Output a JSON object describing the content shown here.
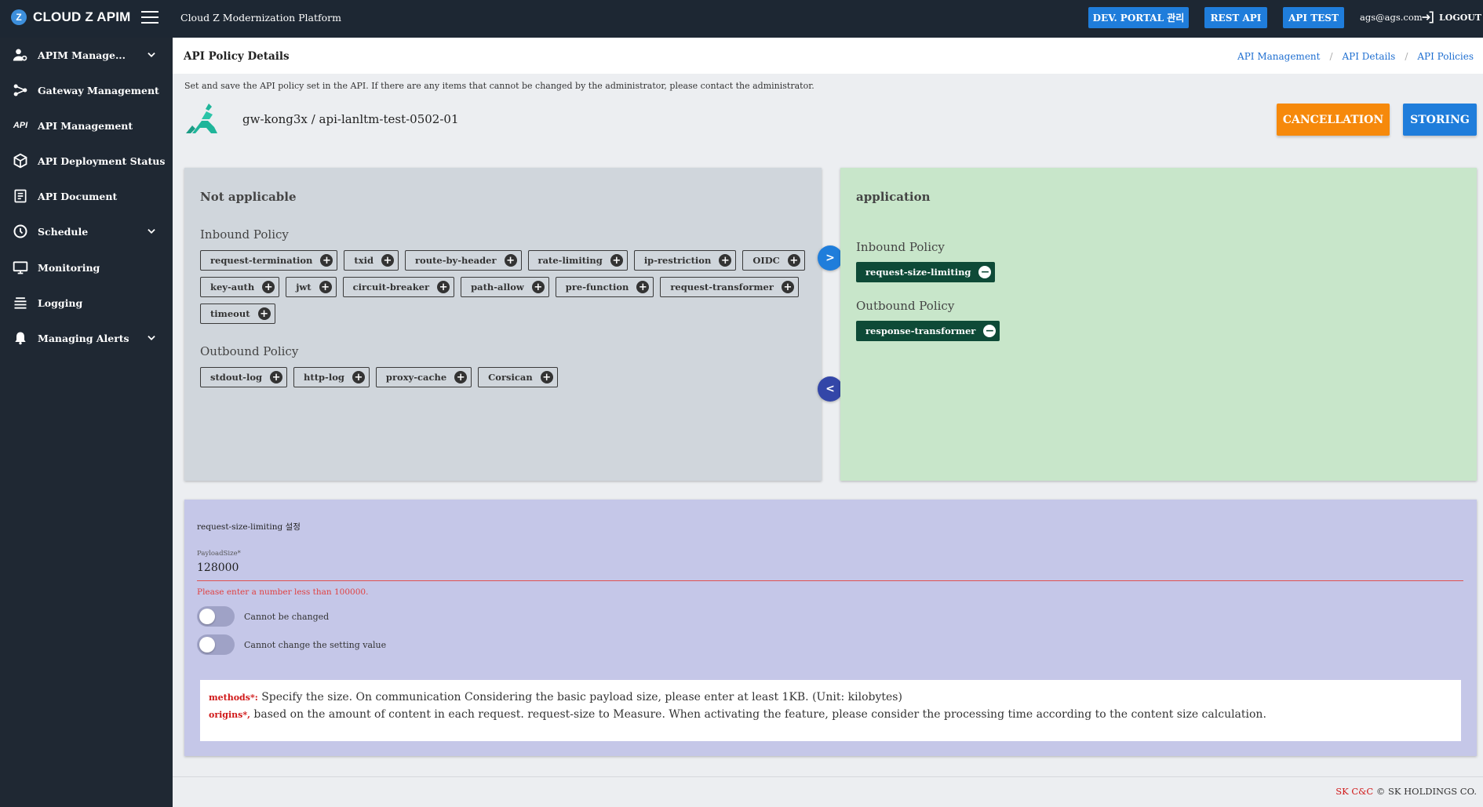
{
  "topbar": {
    "logo_text": "CLOUD Z APIM",
    "logo_letter": "Z",
    "platform_title": "Cloud Z Modernization Platform",
    "buttons": [
      "DEV. PORTAL 관리",
      "REST API",
      "API TEST"
    ],
    "user_email": "ags@ags.com",
    "logout_label": "LOGOUT",
    "colors": {
      "bg": "#1d2733",
      "button": "#1f7ddb"
    }
  },
  "sidebar": {
    "items": [
      {
        "label": "APIM Manage...",
        "icon": "user-gear-icon",
        "expandable": true
      },
      {
        "label": "Gateway Management",
        "icon": "share-nodes-icon",
        "expandable": false
      },
      {
        "label": "API Management",
        "icon": "api-icon",
        "expandable": false
      },
      {
        "label": "API Deployment Status",
        "icon": "cube-icon",
        "expandable": false
      },
      {
        "label": "API Document",
        "icon": "document-icon",
        "expandable": false
      },
      {
        "label": "Schedule",
        "icon": "clock-icon",
        "expandable": true
      },
      {
        "label": "Monitoring",
        "icon": "monitor-icon",
        "expandable": false
      },
      {
        "label": "Logging",
        "icon": "layers-icon",
        "expandable": false
      },
      {
        "label": "Managing Alerts",
        "icon": "bell-icon",
        "expandable": true
      }
    ]
  },
  "header": {
    "title": "API Policy Details",
    "breadcrumb": [
      "API Management",
      "API Details",
      "API Policies"
    ]
  },
  "description": "Set and save the API policy set in the API. If there are any items that cannot be changed by the administrator, please contact the administrator.",
  "api": {
    "gateway": "gw-kong3x",
    "separator": "/",
    "name": "api-lanltm-test-0502-01"
  },
  "actions": {
    "cancel_label": "CANCELLATION",
    "store_label": "STORING",
    "colors": {
      "cancel": "#f6890b",
      "store": "#1f7ddb"
    }
  },
  "not_applicable": {
    "title": "Not applicable",
    "inbound_label": "Inbound Policy",
    "inbound": [
      "request-termination",
      "txid",
      "route-by-header",
      "rate-limiting",
      "ip-restriction",
      "OIDC",
      "key-auth",
      "jwt",
      "circuit-breaker",
      "path-allow",
      "pre-function",
      "request-transformer",
      "timeout"
    ],
    "outbound_label": "Outbound Policy",
    "outbound": [
      "stdout-log",
      "http-log",
      "proxy-cache",
      "Corsican"
    ],
    "bg_color": "#d0d6dc"
  },
  "application": {
    "title": "application",
    "inbound_label": "Inbound Policy",
    "inbound": [
      "request-size-limiting"
    ],
    "outbound_label": "Outbound Policy",
    "outbound": [
      "response-transformer"
    ],
    "bg_color": "#c8e6ca"
  },
  "transfer": {
    "to_application": ">",
    "to_not_applicable": "<"
  },
  "settings": {
    "title": "request-size-limiting 설정",
    "field_label": "PayloadSize*",
    "field_value": "128000",
    "error": "Please enter a number less than 100000.",
    "toggles": [
      {
        "label": "Cannot be changed",
        "on": false
      },
      {
        "label": "Cannot change the setting value",
        "on": false
      }
    ],
    "help": [
      {
        "key": "methods*:",
        "text": "Specify the size. On communication Considering the basic payload size, please enter at least 1KB. (Unit: kilobytes)"
      },
      {
        "key": "origins*,",
        "text": "based on the amount of content in each request. request-size to Measure. When activating the feature, please consider the processing time according to the content size calculation."
      }
    ],
    "bg_color": "#c5c7e8"
  },
  "footer": {
    "brand": "SK C&C",
    "copyright": "© SK HOLDINGS CO."
  }
}
